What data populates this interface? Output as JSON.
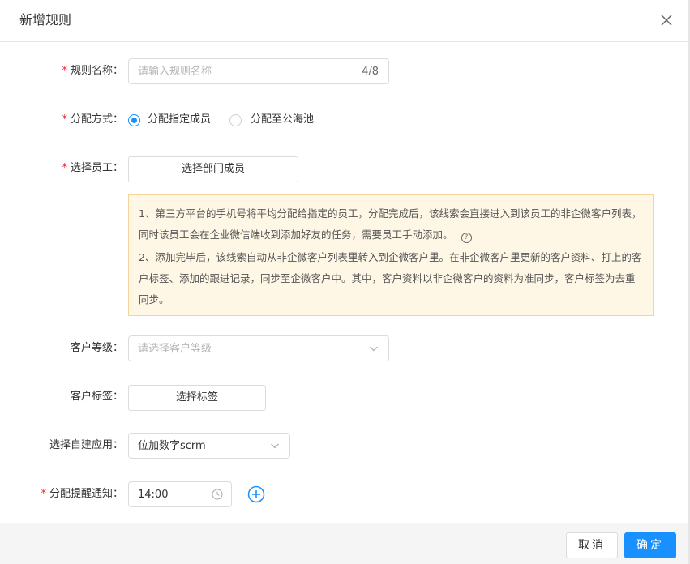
{
  "dialog": {
    "title": "新增规则"
  },
  "form": {
    "rule_name": {
      "label": "规则名称：",
      "required": true,
      "placeholder": "请输入规则名称",
      "counter": "4/8"
    },
    "assign_mode": {
      "label": "分配方式：",
      "required": true,
      "options": [
        {
          "label": "分配指定成员",
          "checked": true
        },
        {
          "label": "分配至公海池",
          "checked": false
        }
      ]
    },
    "select_staff": {
      "label": "选择员工：",
      "required": true,
      "button": "选择部门成员"
    },
    "notice": {
      "line1": "1、第三方平台的手机号将平均分配给指定的员工，分配完成后，该线索会直接进入到该员工的非企微客户列表，同时该员工会在企业微信端收到添加好友的任务，需要员工手动添加。",
      "help_icon": "?",
      "line2": "2、添加完毕后，该线索自动从非企微客户列表里转入到企微客户里。在非企微客户里更新的客户资料、打上的客户标签、添加的跟进记录，同步至企微客户中。其中，客户资料以非企微客户的资料为准同步，客户标签为去重同步。"
    },
    "customer_level": {
      "label": "客户等级：",
      "placeholder": "请选择客户等级"
    },
    "customer_tags": {
      "label": "客户标签：",
      "button": "选择标签"
    },
    "app": {
      "label": "选择自建应用：",
      "value": "位加数字scrm"
    },
    "notify": {
      "label": "分配提醒通知：",
      "required": true,
      "time": "14:00"
    }
  },
  "footer": {
    "cancel": "取消",
    "ok": "确定"
  },
  "colors": {
    "primary": "#1890ff",
    "required": "#f5222d",
    "notice_bg": "#fff7e6",
    "notice_border": "#f6d39c"
  },
  "icons": {
    "close": "close-icon",
    "chevron": "chevron-down-icon",
    "clock": "clock-icon",
    "add": "plus-circle-icon",
    "help": "question-circle-icon"
  }
}
